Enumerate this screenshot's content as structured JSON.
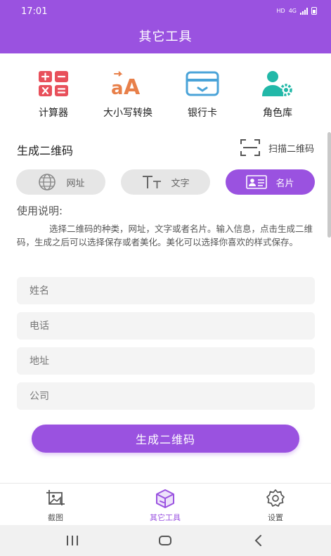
{
  "status": {
    "time": "17:01",
    "network": "HD",
    "cell": "4G"
  },
  "header": {
    "title": "其它工具"
  },
  "tools": [
    {
      "label": "计算器",
      "icon": "calculator-icon"
    },
    {
      "label": "大小写转换",
      "icon": "case-convert-icon"
    },
    {
      "label": "银行卡",
      "icon": "bank-card-icon"
    },
    {
      "label": "角色库",
      "icon": "user-gear-icon"
    }
  ],
  "qr": {
    "title": "生成二维码",
    "scan_label": "扫描二维码",
    "types": [
      {
        "label": "网址",
        "icon": "globe-icon",
        "selected": false
      },
      {
        "label": "文字",
        "icon": "text-size-icon",
        "selected": false
      },
      {
        "label": "名片",
        "icon": "id-card-icon",
        "selected": true
      }
    ],
    "usage_title": "使用说明:",
    "usage_text": "选择二维码的种类，网址，文字或者名片。输入信息，点击生成二维码，生成之后可以选择保存或者美化。美化可以选择你喜欢的样式保存。",
    "fields": [
      {
        "placeholder": "姓名",
        "value": ""
      },
      {
        "placeholder": "电话",
        "value": ""
      },
      {
        "placeholder": "地址",
        "value": ""
      },
      {
        "placeholder": "公司",
        "value": ""
      }
    ],
    "generate_button": "生成二维码"
  },
  "tabs": [
    {
      "label": "截图",
      "icon": "screenshot-icon",
      "active": false
    },
    {
      "label": "其它工具",
      "icon": "toolbox-icon",
      "active": true
    },
    {
      "label": "设置",
      "icon": "settings-gear-icon",
      "active": false
    }
  ],
  "colors": {
    "primary": "#9a52e0",
    "calc": "#e8505b",
    "case": "#e8804a",
    "card": "#4aa3d8",
    "role": "#22b8a8"
  }
}
